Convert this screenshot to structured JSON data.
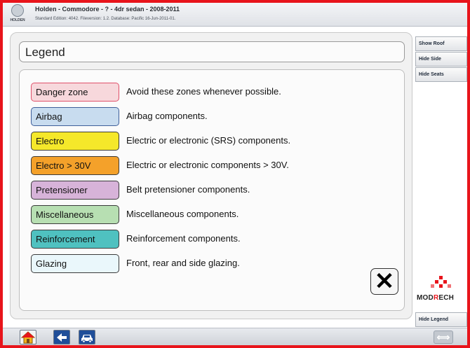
{
  "header": {
    "title": "Holden - Commodore - ? - 4dr sedan - 2008-2011",
    "subtitle": "Standard Edition: 4042. Fileversion: 1.2. Database: Pacific 16-Jun-2011-01.",
    "logo_text": "HOLDEN"
  },
  "legend": {
    "title": "Legend",
    "items": [
      {
        "label": "Danger zone",
        "description": "Avoid these zones whenever possible.",
        "color": "#f7d8dc",
        "border": "#e0506a"
      },
      {
        "label": "Airbag",
        "description": "Airbag components.",
        "color": "#c8dcef",
        "border": "#3f5f9a"
      },
      {
        "label": "Electro",
        "description": "Electric or electronic (SRS) components.",
        "color": "#f5e82a",
        "border": "#3b3b3b"
      },
      {
        "label": "Electro > 30V",
        "description": "Electric or electronic components > 30V.",
        "color": "#f4a12a",
        "border": "#3b3b3b"
      },
      {
        "label": "Pretensioner",
        "description": "Belt pretensioner components.",
        "color": "#d7b3d9",
        "border": "#3b3b3b"
      },
      {
        "label": "Miscellaneous",
        "description": "Miscellaneous components.",
        "color": "#b7dfb2",
        "border": "#3b3b3b"
      },
      {
        "label": "Reinforcement",
        "description": "Reinforcement components.",
        "color": "#4fc1c0",
        "border": "#3b3b3b"
      },
      {
        "label": "Glazing",
        "description": "Front, rear and side glazing.",
        "color": "#eaf7fb",
        "border": "#3b3b3b"
      }
    ],
    "close_glyph": "✕"
  },
  "side": {
    "show_roof": "Show Roof",
    "hide_side": "Hide Side",
    "hide_seats": "Hide Seats",
    "hide_legend": "Hide Legend"
  },
  "brand": {
    "name_part1": "MOD",
    "name_part2": "R",
    "name_part3": "ECH"
  },
  "bottom": {
    "expand_glyph": "⟺"
  }
}
